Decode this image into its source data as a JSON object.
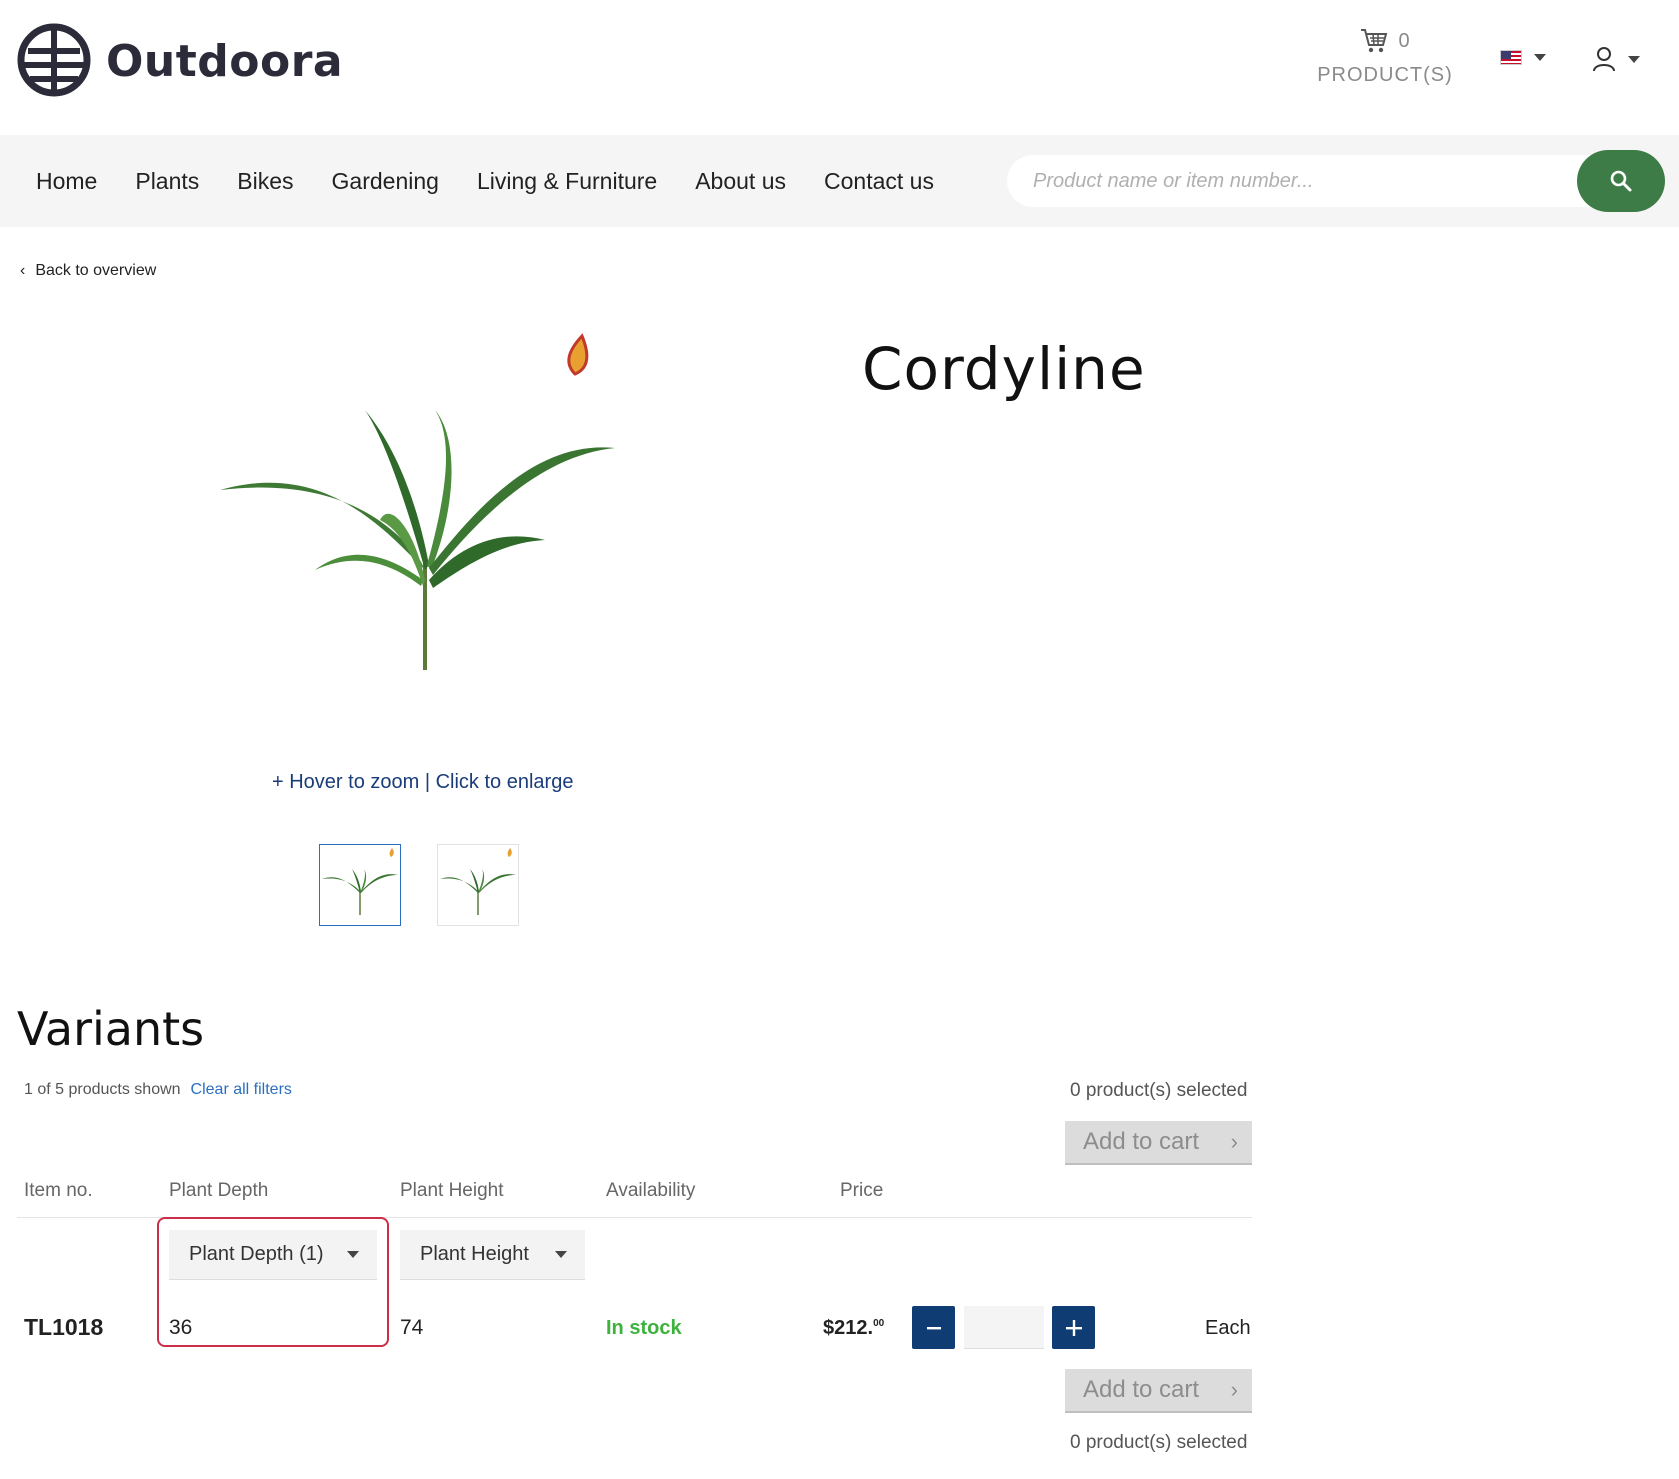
{
  "header": {
    "brand": "Outdoora",
    "cart_count": "0",
    "cart_label": "PRODUCT(S)"
  },
  "nav": {
    "items": [
      "Home",
      "Plants",
      "Bikes",
      "Gardening",
      "Living & Furniture",
      "About us",
      "Contact us"
    ],
    "search_placeholder": "Product name or item number..."
  },
  "back_label": "Back to overview",
  "product": {
    "title": "Cordyline",
    "zoom_hint": "+ Hover to zoom | Click to enlarge"
  },
  "variants": {
    "title": "Variants",
    "shown_text": "1 of 5 products shown",
    "clear_filters": "Clear all filters",
    "selected_text": "0 product(s) selected",
    "add_to_cart": "Add to cart",
    "columns": [
      "Item no.",
      "Plant Depth",
      "Plant Height",
      "Availability",
      "Price"
    ],
    "filters": {
      "depth": "Plant Depth (1)",
      "height": "Plant Height"
    },
    "rows": [
      {
        "item_no": "TL1018",
        "depth": "36",
        "height": "74",
        "availability": "In stock",
        "price_main": "$212.",
        "price_cents": "00",
        "quantity": "",
        "unit": "Each"
      }
    ]
  },
  "colors": {
    "accent_green": "#3d7c47",
    "qty_button": "#0f3d73",
    "stock_green": "#3db33d",
    "highlight": "#cc2d48",
    "link_blue": "#2a6fbf"
  }
}
